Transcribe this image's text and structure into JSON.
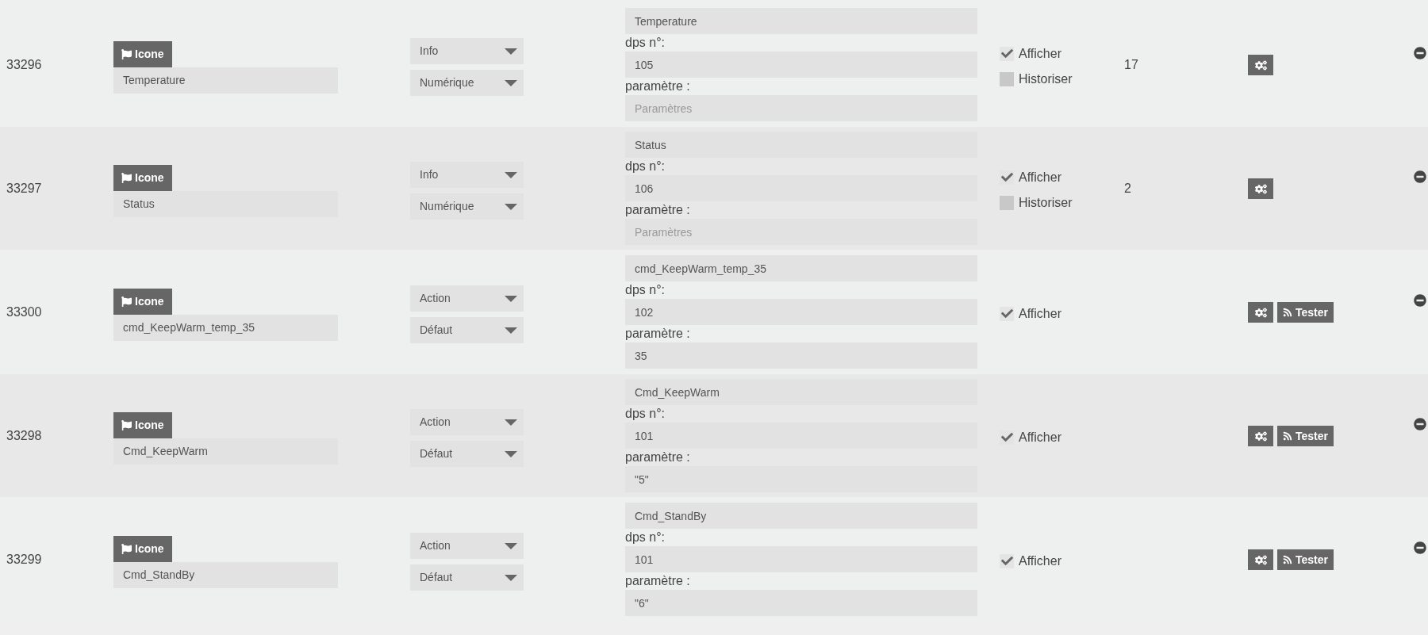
{
  "rows": [
    {
      "id": "33296",
      "icon_button": "Icone",
      "name": "Temperature",
      "type": "Info",
      "subtype": "Numérique",
      "logical_id": "Temperature",
      "dps_label": "dps n°:",
      "dps": "105",
      "param_label": "paramètre :",
      "param": {
        "placeholder": "Paramètres"
      },
      "checkboxes": [
        {
          "label": "Afficher",
          "checked": true
        },
        {
          "label": "Historiser",
          "checked": false
        }
      ],
      "value": "17",
      "test_button": null
    },
    {
      "id": "33297",
      "icon_button": "Icone",
      "name": "Status",
      "type": "Info",
      "subtype": "Numérique",
      "logical_id": "Status",
      "dps_label": "dps n°:",
      "dps": "106",
      "param_label": "paramètre :",
      "param": {
        "placeholder": "Paramètres"
      },
      "checkboxes": [
        {
          "label": "Afficher",
          "checked": true
        },
        {
          "label": "Historiser",
          "checked": false
        }
      ],
      "value": "2",
      "test_button": null
    },
    {
      "id": "33300",
      "icon_button": "Icone",
      "name": "cmd_KeepWarm_temp_35",
      "type": "Action",
      "subtype": "Défaut",
      "logical_id": "cmd_KeepWarm_temp_35",
      "dps_label": "dps n°:",
      "dps": "102",
      "param_label": "paramètre :",
      "param": {
        "value": "35"
      },
      "checkboxes": [
        {
          "label": "Afficher",
          "checked": true
        }
      ],
      "test_button": "Tester"
    },
    {
      "id": "33298",
      "icon_button": "Icone",
      "name": "Cmd_KeepWarm",
      "type": "Action",
      "subtype": "Défaut",
      "logical_id": "Cmd_KeepWarm",
      "dps_label": "dps n°:",
      "dps": "101",
      "param_label": "paramètre :",
      "param": {
        "value": "\"5\""
      },
      "checkboxes": [
        {
          "label": "Afficher",
          "checked": true
        }
      ],
      "test_button": "Tester"
    },
    {
      "id": "33299",
      "icon_button": "Icone",
      "name": "Cmd_StandBy",
      "type": "Action",
      "subtype": "Défaut",
      "logical_id": "Cmd_StandBy",
      "dps_label": "dps n°:",
      "dps": "101",
      "param_label": "paramètre :",
      "param": {
        "value": "\"6\""
      },
      "checkboxes": [
        {
          "label": "Afficher",
          "checked": true
        }
      ],
      "test_button": "Tester"
    }
  ]
}
